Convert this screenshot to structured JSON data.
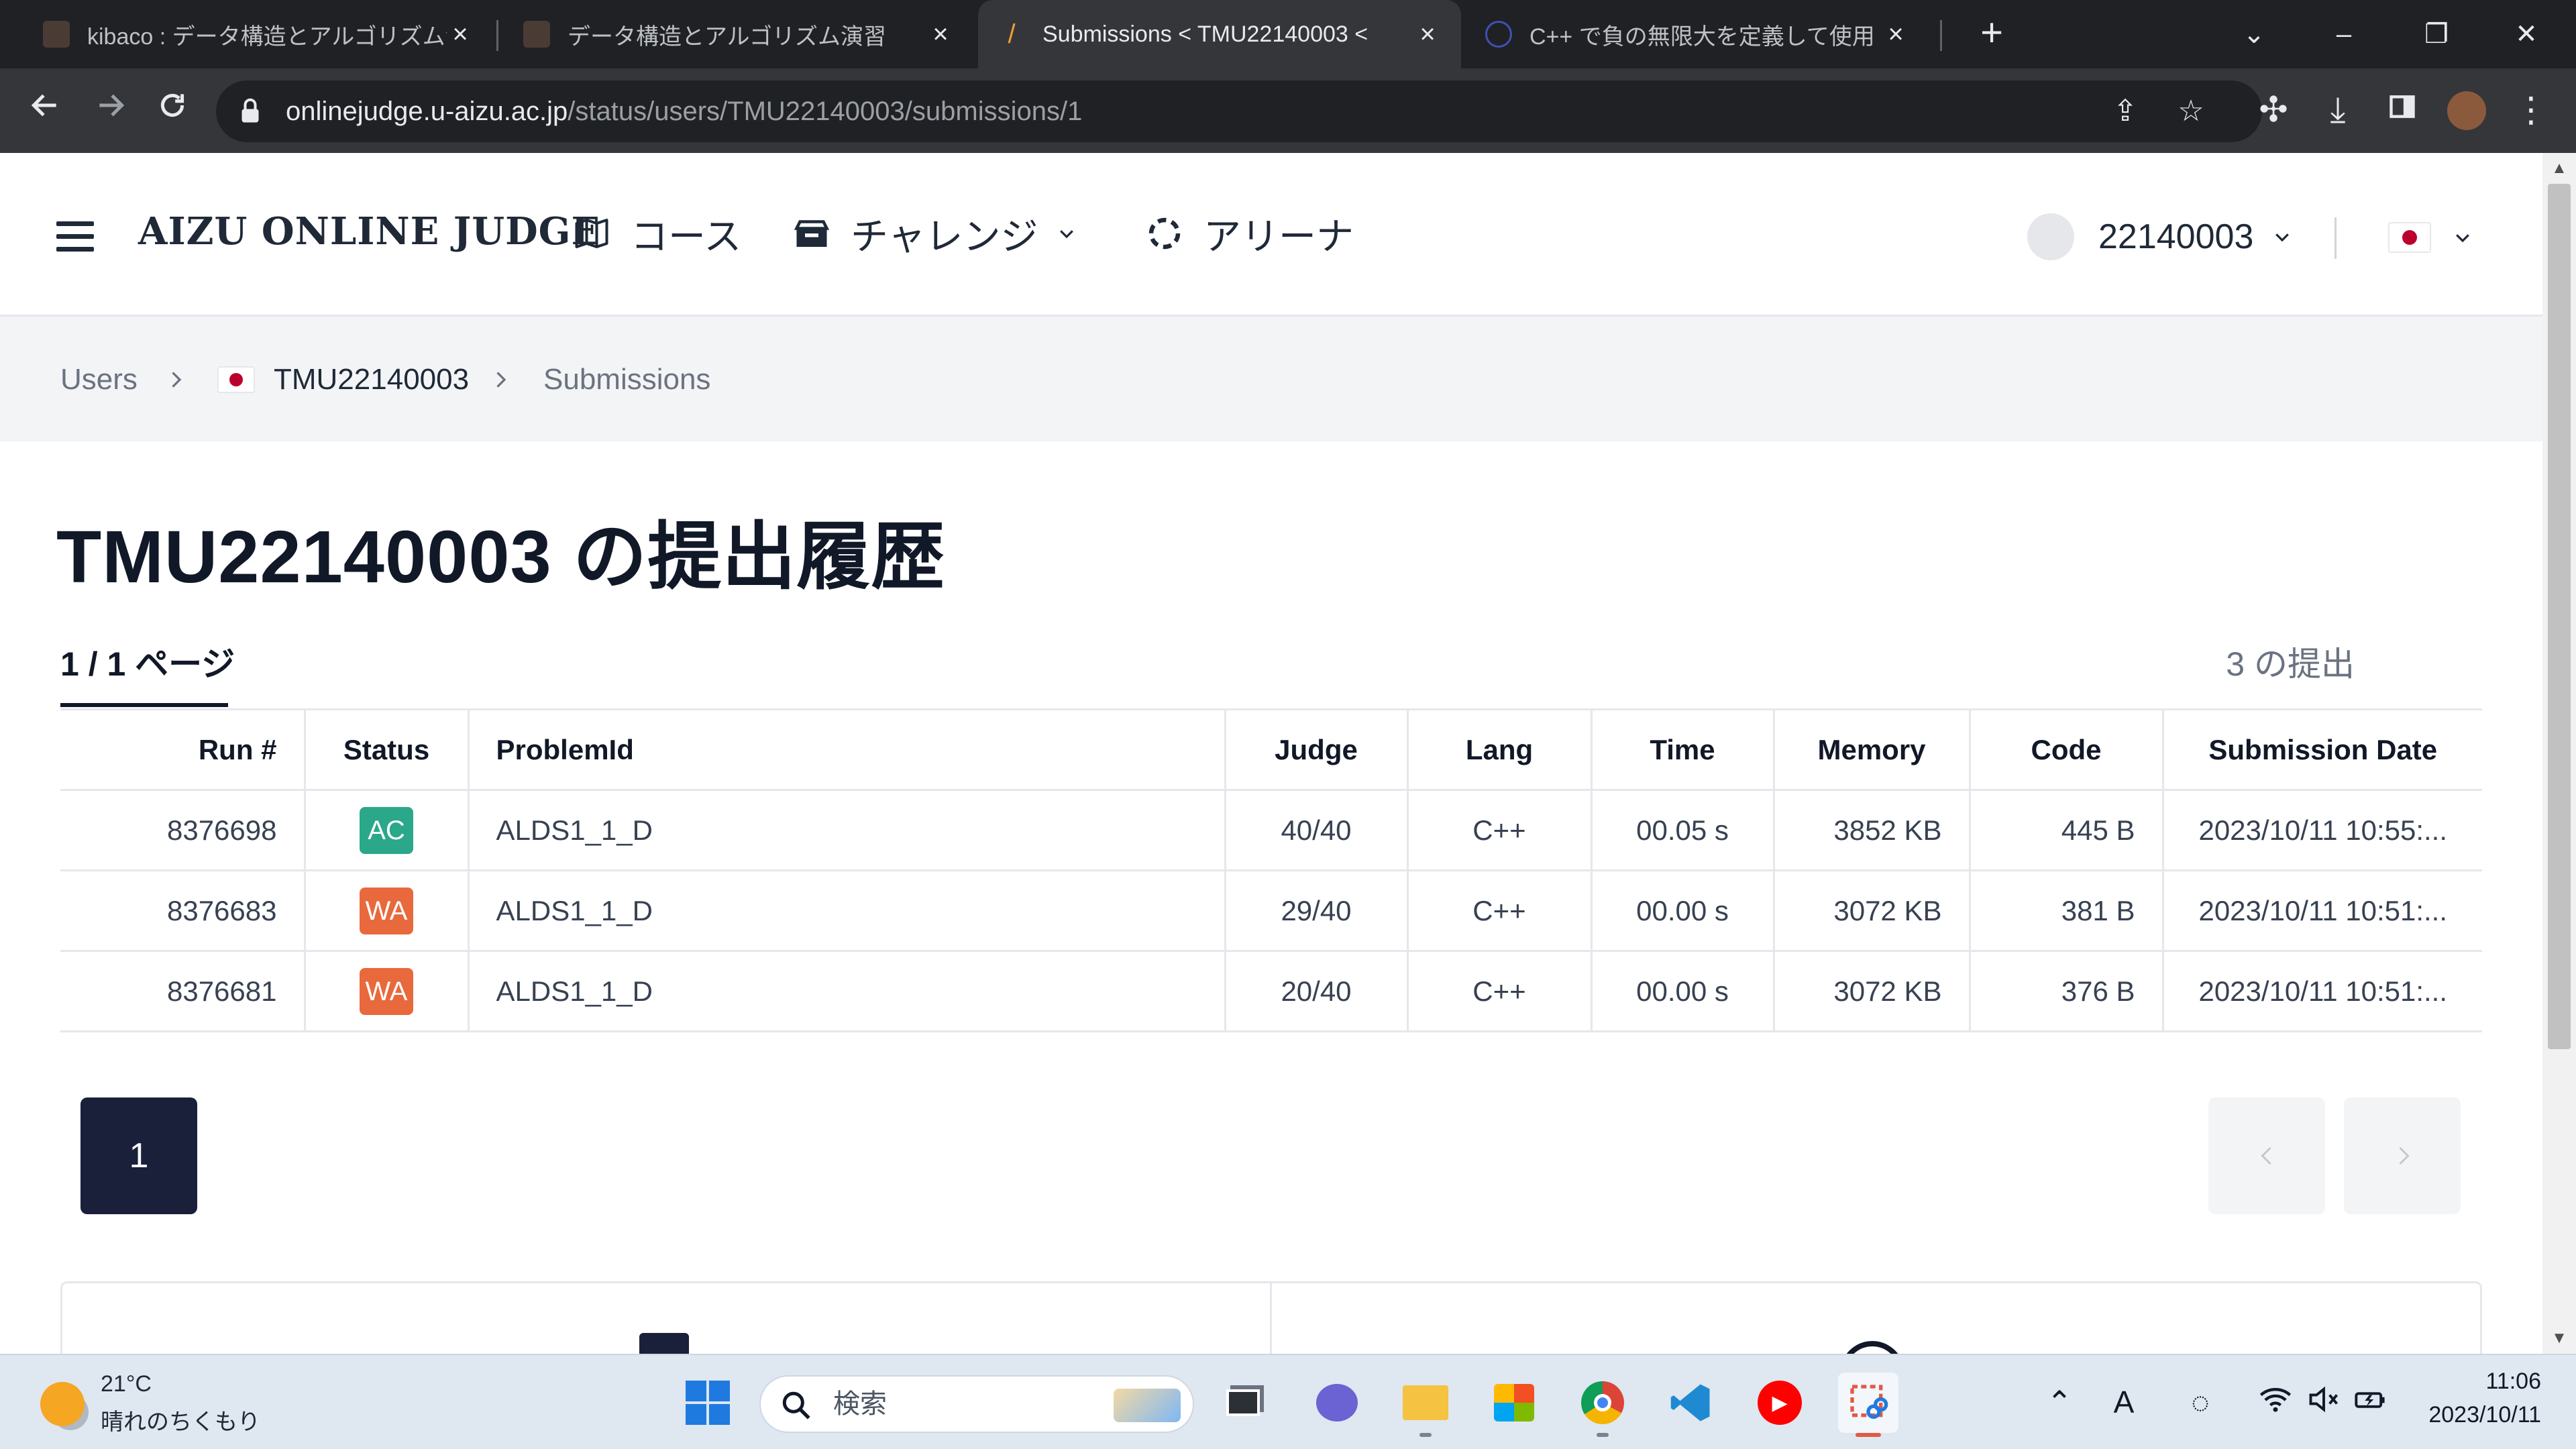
{
  "browser": {
    "tabs": [
      {
        "title": "kibaco : データ構造とアルゴリズム演",
        "active": false
      },
      {
        "title": "データ構造とアルゴリズム演習",
        "active": false
      },
      {
        "title": "Submissions < TMU22140003 <",
        "active": true
      },
      {
        "title": "C++ で負の無限大を定義して使用",
        "active": false
      }
    ],
    "new_tab": "+",
    "url_host": "onlinejudge.u-aizu.ac.jp",
    "url_path": "/status/users/TMU22140003/submissions/1"
  },
  "site": {
    "brand": "AIZU ONLINE JUDGE",
    "nav": {
      "course": "コース",
      "challenge": "チャレンジ",
      "arena": "アリーナ"
    },
    "user_id": "22140003"
  },
  "breadcrumb": {
    "users": "Users",
    "user": "TMU22140003",
    "current": "Submissions"
  },
  "main": {
    "title": "TMU22140003 の提出履歴",
    "page_indicator": "1 / 1 ページ",
    "submission_count": "3 の提出"
  },
  "table": {
    "headers": {
      "run": "Run #",
      "status": "Status",
      "problem": "ProblemId",
      "judge": "Judge",
      "lang": "Lang",
      "time": "Time",
      "memory": "Memory",
      "code": "Code",
      "date": "Submission Date"
    },
    "rows": [
      {
        "run": "8376698",
        "status": "AC",
        "status_color": "#2aa889",
        "problem": "ALDS1_1_D",
        "judge": "40/40",
        "lang": "C++",
        "time": "00.05 s",
        "memory": "3852 KB",
        "code": "445 B",
        "date": "2023/10/11 10:55:..."
      },
      {
        "run": "8376683",
        "status": "WA",
        "status_color": "#e8693c",
        "problem": "ALDS1_1_D",
        "judge": "29/40",
        "lang": "C++",
        "time": "00.00 s",
        "memory": "3072 KB",
        "code": "381 B",
        "date": "2023/10/11 10:51:..."
      },
      {
        "run": "8376681",
        "status": "WA",
        "status_color": "#e8693c",
        "problem": "ALDS1_1_D",
        "judge": "20/40",
        "lang": "C++",
        "time": "00.00 s",
        "memory": "3072 KB",
        "code": "376 B",
        "date": "2023/10/11 10:51:..."
      }
    ]
  },
  "pagination": {
    "current_page": "1"
  },
  "taskbar": {
    "weather_temp": "21°C",
    "weather_desc": "晴れのちくもり",
    "search_placeholder": "検索",
    "ime": "A",
    "time": "11:06",
    "date": "2023/10/11"
  },
  "colors": {
    "accent_dark": "#1a1f3a",
    "ac": "#2aa889",
    "wa": "#e8693c"
  }
}
